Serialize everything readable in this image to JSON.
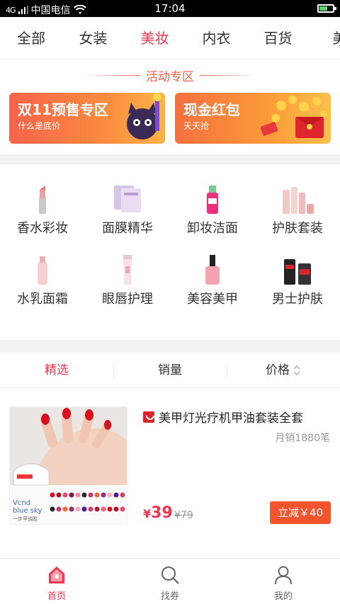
{
  "status_bar": {
    "carrier": "中国电信",
    "signal_text": "4G",
    "time": "17:04",
    "battery_level": 0.6
  },
  "category_tabs": [
    {
      "label": "全部"
    },
    {
      "label": "女装"
    },
    {
      "label": "美妆",
      "active": true
    },
    {
      "label": "内衣"
    },
    {
      "label": "百货"
    },
    {
      "label": "美"
    }
  ],
  "activity": {
    "title": "活动专区",
    "banners": [
      {
        "title": "双11预售专区",
        "subtitle": "什么是底价"
      },
      {
        "title": "现金红包",
        "subtitle": "天天抢"
      }
    ]
  },
  "grid": [
    {
      "label": "香水彩妆",
      "icon": "lipstick-icon"
    },
    {
      "label": "面膜精华",
      "icon": "face-mask-icon"
    },
    {
      "label": "卸妆洁面",
      "icon": "cleanser-bottle-icon"
    },
    {
      "label": "护肤套装",
      "icon": "skincare-set-icon"
    },
    {
      "label": "水乳面霜",
      "icon": "lotion-bottle-icon"
    },
    {
      "label": "眼唇护理",
      "icon": "eye-cream-tube-icon"
    },
    {
      "label": "美容美甲",
      "icon": "nail-polish-icon"
    },
    {
      "label": "男士护肤",
      "icon": "mens-skincare-icon"
    }
  ],
  "sort": {
    "options": [
      {
        "label": "精选",
        "active": true
      },
      {
        "label": "销量"
      },
      {
        "label": "价格"
      }
    ]
  },
  "products": [
    {
      "title": "美甲灯光疗机甲油套装全套",
      "sales": "月销1880笔",
      "price_symbol": "¥",
      "price": "39",
      "old_price": "¥79",
      "coupon": "立减￥40",
      "image_text": "Vcnd blue sky",
      "image_subtext": "一步甲油胶"
    }
  ],
  "bottom_nav": [
    {
      "label": "首页",
      "icon": "home-icon",
      "active": true
    },
    {
      "label": "找券",
      "icon": "search-icon"
    },
    {
      "label": "我的",
      "icon": "user-icon"
    }
  ],
  "colors": {
    "accent": "#f0364e",
    "activity": "#f2604b",
    "coupon": "#f2542d"
  }
}
